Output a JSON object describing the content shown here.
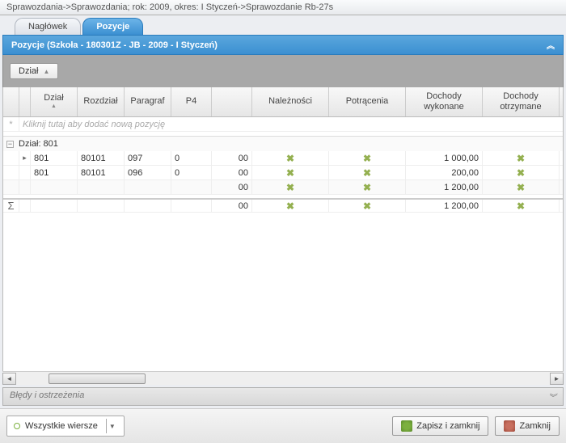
{
  "titlebar": "Sprawozdania->Sprawozdania; rok: 2009, okres: I Styczeń->Sprawozdanie Rb-27s",
  "tabs": {
    "header": "Nagłówek",
    "items": "Pozycje"
  },
  "section_title": "Pozycje  (Szkoła - 180301Z - JB - 2009 - I Styczeń)",
  "group_by_label": "Dział",
  "columns": {
    "dzial": "Dział",
    "rozdzial": "Rozdział",
    "paragraf": "Paragraf",
    "p4": "P4",
    "naleznosci": "Należności",
    "potracenia": "Potrącenia",
    "dochody_wykonane": "Dochody wykonane",
    "dochody_otrzymane": "Dochody otrzymane"
  },
  "new_row_hint": "Kliknij tutaj aby dodać nową pozycję",
  "group_label": "Dział: 801",
  "rows": [
    {
      "dzial": "801",
      "rozdzial": "80101",
      "paragraf": "097",
      "p4": "0",
      "blank": "00",
      "dwyk": "1 000,00"
    },
    {
      "dzial": "801",
      "rozdzial": "80101",
      "paragraf": "096",
      "p4": "0",
      "blank": "00",
      "dwyk": "200,00"
    }
  ],
  "subtotal": {
    "blank": "00",
    "dwyk": "1 200,00"
  },
  "grand": {
    "blank": "00",
    "dwyk": "1 200,00"
  },
  "errors_label": "Błędy i ostrzeżenia",
  "filter_label": "Wszystkie wiersze",
  "buttons": {
    "save_close": "Zapisz i zamknij",
    "close": "Zamknij"
  }
}
